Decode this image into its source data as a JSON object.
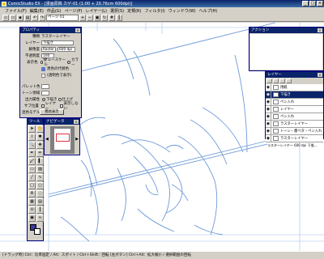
{
  "window": {
    "title": "ComicStudio EX - [漫画原稿 カゲ-01 (1:00 + 20.76cm 600dpi)]"
  },
  "menu": [
    "ファイル(F)",
    "編集(E)",
    "作品(G)",
    "ページ(P)",
    "レイヤー(L)",
    "選択(S)",
    "定規(R)",
    "フィルタ(I)",
    "ウィンドウ(W)",
    "ヘルプ(H)"
  ],
  "toolbar": {
    "page_select": "ページ 01"
  },
  "properties": {
    "title": "プロパティ",
    "type_label": "種類",
    "type_value": "ラスターレイヤー",
    "layer_label": "レイヤー",
    "layer_value": "下描き",
    "resolution_label": "解像度",
    "resolution_value": "Raster",
    "resolution_dpi": "600 dpi",
    "opacity_label": "不透明度",
    "opacity_value": "100 %",
    "display_label": "表示色",
    "display_gray": "グレースケール",
    "display_color": "カラー",
    "color_option_1": "黒色の代替色",
    "color_option_2": "(透明色で表示)",
    "palette_label": "パレット色",
    "tone_label": "トーン領域",
    "output_label": "出力属性",
    "output_under": "下描き",
    "output_finish": "仕上げ",
    "sub_label": "サブ位置",
    "sub_show": "レイヤー",
    "sub_hide": "表示しない",
    "combine_label": "混色モデル",
    "detail_button": "簡易表示"
  },
  "tools": {
    "title": "ツール",
    "icons": [
      "arrow-icon",
      "hand-icon",
      "lasso-icon",
      "magic-wand-icon",
      "zoom-icon",
      "move-icon",
      "pen-icon",
      "pencil-icon",
      "brush-icon",
      "marker-icon",
      "eraser-icon",
      "fill-icon",
      "line-icon",
      "curve-icon",
      "rect-icon",
      "ellipse-icon",
      "text-icon",
      "balloon-icon",
      "tone-icon",
      "gradient-icon",
      "eyedropper-icon",
      "ruler-icon",
      "frame-icon",
      "blur-icon"
    ]
  },
  "navigator": {
    "title": "ナビゲータ"
  },
  "action": {
    "title": "アクション"
  },
  "layers": {
    "title": "レイヤー",
    "rows": [
      {
        "name": "用紙",
        "selected": false
      },
      {
        "name": "下描き",
        "selected": true
      },
      {
        "name": "ペン入れ",
        "selected": false
      },
      {
        "name": "レイヤー",
        "selected": false
      },
      {
        "name": "ペン入れ",
        "selected": false
      },
      {
        "name": "ラスターレイヤー",
        "selected": false
      },
      {
        "name": "トーン・墨ベタ・ペン入れ",
        "selected": false
      },
      {
        "name": "ラスターレイヤー",
        "selected": false
      }
    ],
    "status": "ラスターレイヤー 600 dpi 下描…"
  },
  "status_text": "[ドラッグ時] Ctrl：比率固定 / Alt：スポイト / Ctrl＋Shift：回転 [左ボタン] Ctrl＋Alt：拡大縮小 / 選択範囲の回転"
}
